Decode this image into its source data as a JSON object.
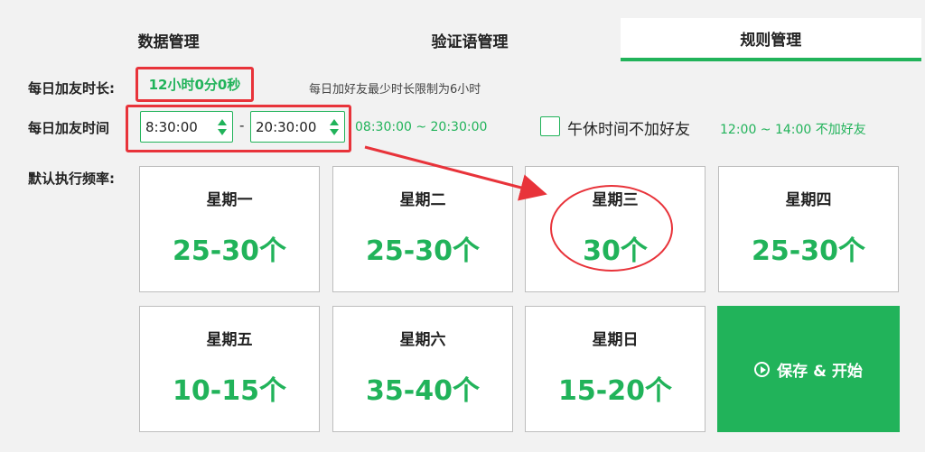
{
  "tabs": [
    {
      "label": "数据管理",
      "active": false
    },
    {
      "label": "验证语管理",
      "active": false
    },
    {
      "label": "规则管理",
      "active": true
    }
  ],
  "daily_duration": {
    "label": "每日加友时长:",
    "value": "12小时0分0秒",
    "hint": "每日加好友最少时长限制为6小时"
  },
  "daily_time": {
    "label": "每日加友时间",
    "start": "8:30:00",
    "separator": "-",
    "end": "20:30:00",
    "range_note": "08:30:00 ~ 20:30:00"
  },
  "lunch_break": {
    "checked": false,
    "label": "午休时间不加好友",
    "note": "12:00 ~ 14:00 不加好友"
  },
  "frequency": {
    "label": "默认执行频率:",
    "days": [
      {
        "day": "星期一",
        "count": "25-30个"
      },
      {
        "day": "星期二",
        "count": "25-30个"
      },
      {
        "day": "星期三",
        "count": "30个"
      },
      {
        "day": "星期四",
        "count": "25-30个"
      },
      {
        "day": "星期五",
        "count": "10-15个"
      },
      {
        "day": "星期六",
        "count": "35-40个"
      },
      {
        "day": "星期日",
        "count": "15-20个"
      }
    ]
  },
  "start_button": {
    "label": "保存 & 开始"
  },
  "colors": {
    "accent": "#21b35a",
    "annotation": "#e8333a",
    "background": "#f2f2f2"
  }
}
